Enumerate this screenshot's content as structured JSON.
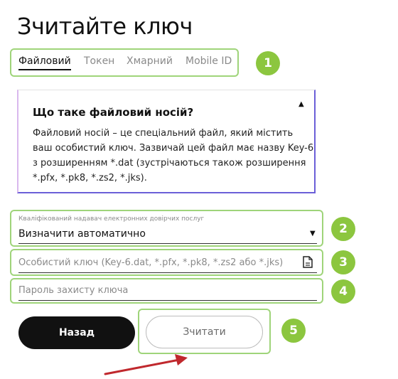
{
  "page": {
    "title": "Зчитайте ключ"
  },
  "tabs": [
    {
      "label": "Файловий",
      "active": true
    },
    {
      "label": "Токен",
      "active": false
    },
    {
      "label": "Хмарний",
      "active": false
    },
    {
      "label": "Mobile ID",
      "active": false
    }
  ],
  "info": {
    "title": "Що таке файловий носій?",
    "text": "Файловий носій – це спеціальний файл, який містить ваш особистий ключ. Зазвичай цей файл має назву Key-6 з розширенням *.dat (зустрічаються також розширення *.pfx, *.pk8, *.zs2, *.jks).",
    "chevron": "▲"
  },
  "provider": {
    "label": "Кваліфікований надавач електронних довірчих послуг",
    "value": "Визначити автоматично",
    "arrow": "▼"
  },
  "key_file": {
    "placeholder": "Особистий ключ (Key-6.dat, *.pfx, *.pk8, *.zs2 або *.jks)"
  },
  "password": {
    "placeholder": "Пароль захисту ключа"
  },
  "buttons": {
    "back": "Назад",
    "read": "Зчитати"
  },
  "badges": [
    "1",
    "2",
    "3",
    "4",
    "5"
  ],
  "colors": {
    "highlight": "#9fd47a",
    "badge": "#8cc63f",
    "arrow": "#c0282d",
    "card_accent": "#6b5fd8"
  }
}
